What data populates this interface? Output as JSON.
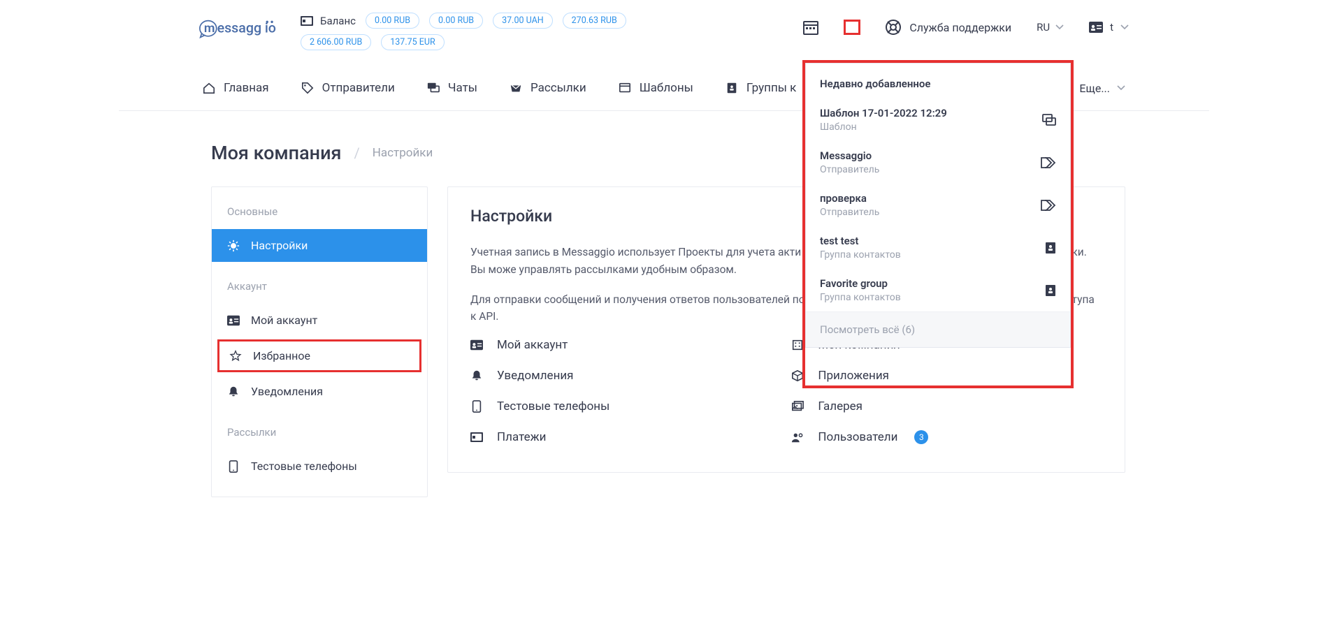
{
  "header": {
    "balance_label": "Баланс",
    "pills_row1": [
      "0.00 RUB",
      "0.00 RUB",
      "37.00 UAH",
      "270.63 RUB"
    ],
    "pills_row2": [
      "2 606.00 RUB",
      "137.75 EUR"
    ],
    "support_label": "Служба поддержки",
    "lang": "RU",
    "user_initial": "t"
  },
  "nav": {
    "items": [
      {
        "label": "Главная"
      },
      {
        "label": "Отправители"
      },
      {
        "label": "Чаты"
      },
      {
        "label": "Рассылки"
      },
      {
        "label": "Шаблоны"
      },
      {
        "label": "Группы к"
      }
    ],
    "more": "Еще..."
  },
  "breadcrumb": {
    "title": "Моя компания",
    "sep": "/",
    "sub": "Настройки"
  },
  "sidebar": {
    "section_basic": "Основные",
    "item_settings": "Настройки",
    "section_account": "Аккаунт",
    "item_my_account": "Мой аккаунт",
    "item_favorites": "Избранное",
    "item_notifications": "Уведомления",
    "section_mailing": "Рассылки",
    "item_test_phones": "Тестовые телефоны"
  },
  "main": {
    "title": "Настройки",
    "para1": "Учетная запись в Messaggio использует Проекты для учета акти       имена отправителей, шаблоны сообщений и рассылки. Вы може    управлять рассылками удобным образом.",
    "para2": "Для отправки сообщений и получения ответов пользователей по                                                                                                                                  а обработчиков уведомлений, получить токены доступа к API.",
    "links_left": [
      {
        "label": "Мой аккаунт"
      },
      {
        "label": "Уведомления"
      },
      {
        "label": "Тестовые телефоны"
      },
      {
        "label": "Платежи"
      }
    ],
    "links_right": [
      {
        "label": "Моя компания"
      },
      {
        "label": "Приложения"
      },
      {
        "label": "Галерея"
      },
      {
        "label": "Пользователи",
        "badge": "3"
      }
    ]
  },
  "dropdown": {
    "title": "Недавно добавленное",
    "items": [
      {
        "title": "Шаблон 17-01-2022 12:29",
        "subtitle": "Шаблон",
        "icon": "template"
      },
      {
        "title": "Messaggio",
        "subtitle": "Отправитель",
        "icon": "tag"
      },
      {
        "title": "проверка",
        "subtitle": "Отправитель",
        "icon": "tag"
      },
      {
        "title": "test test",
        "subtitle": "Группа контактов",
        "icon": "book"
      },
      {
        "title": "Favorite group",
        "subtitle": "Группа контактов",
        "icon": "book"
      }
    ],
    "footer": "Посмотреть всё (6)"
  }
}
